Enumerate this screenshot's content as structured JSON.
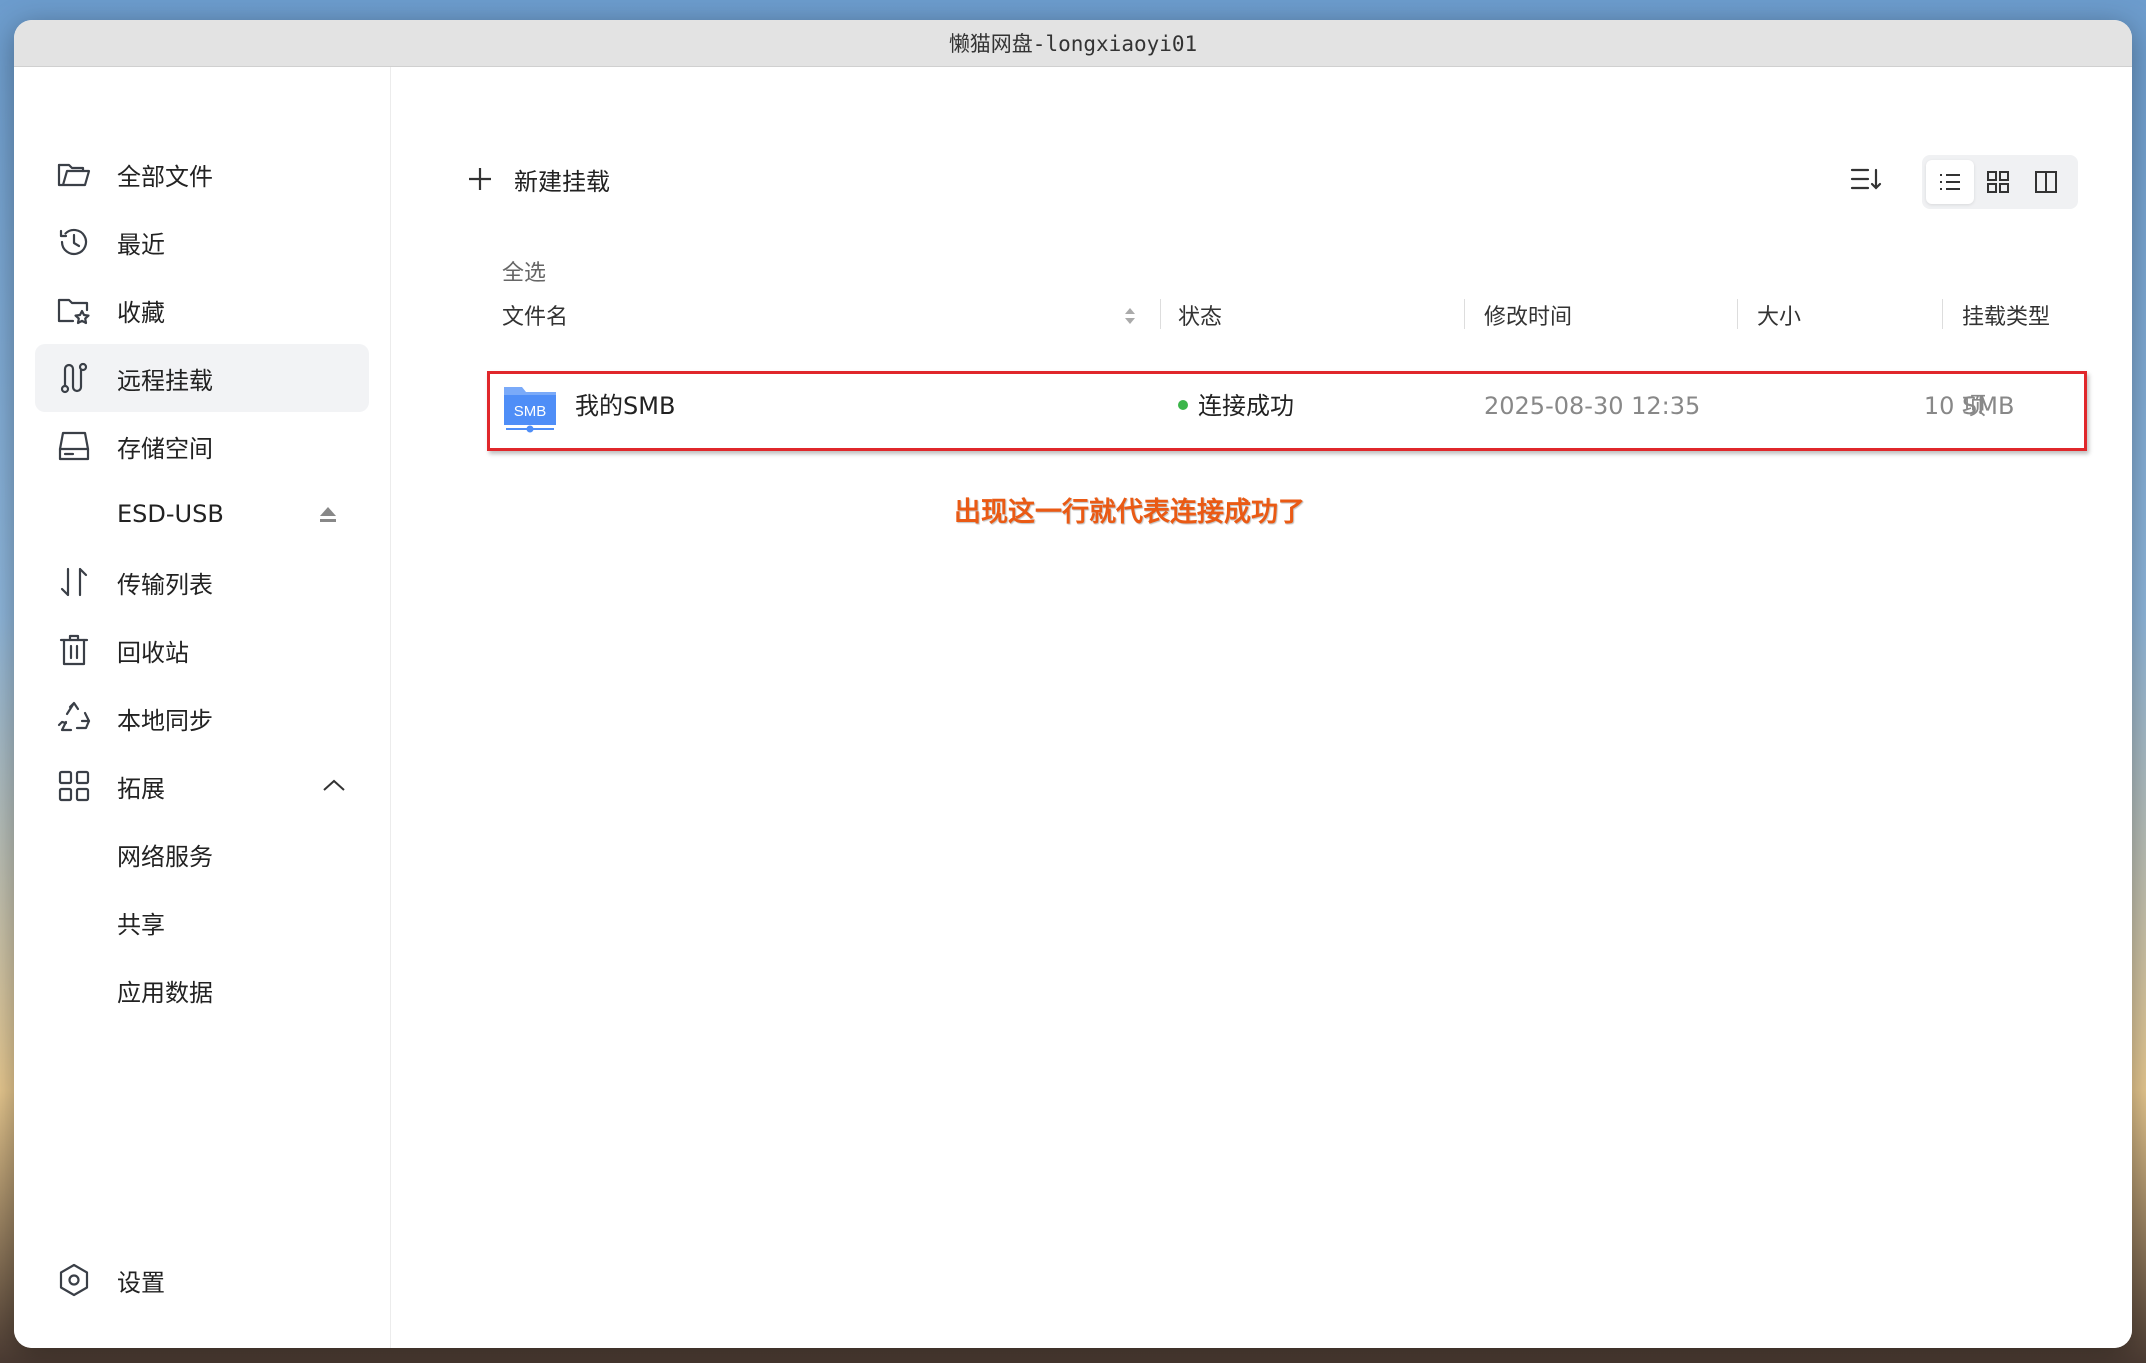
{
  "window": {
    "title": "懒猫网盘-longxiaoyi01"
  },
  "sidebar": {
    "items": [
      {
        "label": "全部文件",
        "icon": "folder-open-icon"
      },
      {
        "label": "最近",
        "icon": "history-icon"
      },
      {
        "label": "收藏",
        "icon": "folder-star-icon"
      },
      {
        "label": "远程挂载",
        "icon": "remote-mount-icon",
        "active": true
      },
      {
        "label": "存储空间",
        "icon": "hard-drive-icon"
      },
      {
        "label": "ESD-USB",
        "icon": "eject-icon"
      },
      {
        "label": "传输列表",
        "icon": "transfer-icon"
      },
      {
        "label": "回收站",
        "icon": "trash-icon"
      },
      {
        "label": "本地同步",
        "icon": "recycle-sync-icon"
      },
      {
        "label": "拓展",
        "icon": "grid-apps-icon"
      },
      {
        "label": "网络服务"
      },
      {
        "label": "共享"
      },
      {
        "label": "应用数据"
      }
    ],
    "settings": {
      "label": "设置",
      "icon": "settings-icon"
    }
  },
  "toolbar": {
    "new_mount_label": "新建挂载"
  },
  "list": {
    "select_all": "全选",
    "columns": [
      "文件名",
      "状态",
      "修改时间",
      "大小",
      "挂载类型"
    ],
    "rows": [
      {
        "name": "我的SMB",
        "icon_text": "SMB",
        "status": "连接成功",
        "modified": "2025-08-30 12:35",
        "size": "10 项",
        "type": "SMB"
      }
    ]
  },
  "annotation": "出现这一行就代表连接成功了",
  "colors": {
    "accent_red": "#e0272b",
    "annotation": "#ea5a14",
    "status_ok": "#3bb54a",
    "file_icon_blue": "#4f8ef7"
  }
}
